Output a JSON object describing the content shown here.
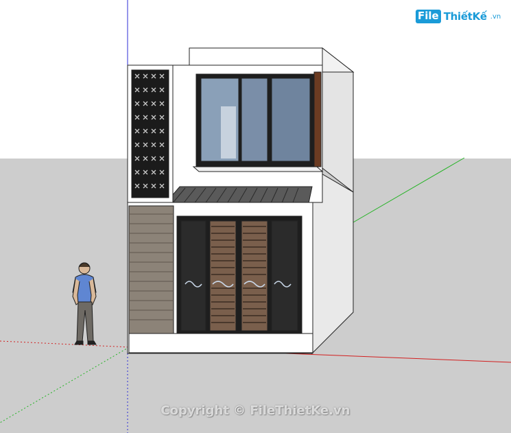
{
  "watermark": {
    "logo_mark": "File",
    "logo_rest": "ThiếtKế",
    "logo_domain": ".vn",
    "copyright": "Copyright © FileThietKe.vn"
  },
  "colors": {
    "sky": "#ffffff",
    "ground": "#cdcdcd",
    "axis_red": "#d21e1e",
    "axis_green": "#22b322",
    "axis_blue": "#2b2bd6",
    "wall_white": "#ffffff",
    "wall_side": "#e9e9e9",
    "wall_shade": "#bdbdbd",
    "glass": "#7b8fa8",
    "frame_dark": "#1e1e1e",
    "wood": "#7a5f4c",
    "stone": "#8c8378",
    "shirt": "#5f86d2",
    "pants": "#6e6a64",
    "accent_logo": "#1a9bd8"
  },
  "scene": {
    "model": "two-storey-townhouse",
    "figure": "scale-person"
  }
}
